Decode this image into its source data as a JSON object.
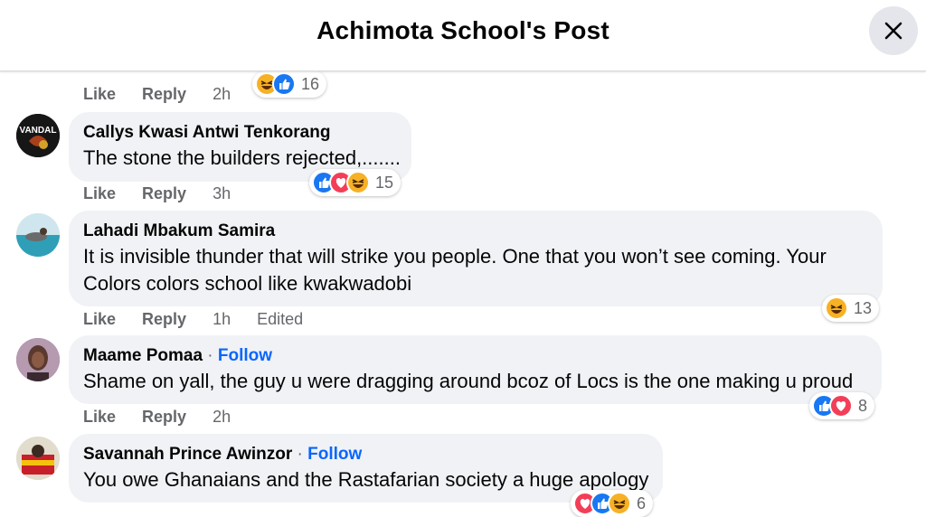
{
  "header": {
    "title": "Achimota School's Post"
  },
  "colors": {
    "link": "#0866ff",
    "like": "#1877f2",
    "love": "#f33e58",
    "haha": "#f7b125",
    "bubble": "#f0f2f5"
  },
  "prev_comment": {
    "actions": {
      "like": "Like",
      "reply": "Reply",
      "time": "2h"
    },
    "reactions": {
      "icons": [
        "haha-icon",
        "like-icon"
      ],
      "count": "16"
    }
  },
  "comments": [
    {
      "author": "Callys Kwasi Antwi Tenkorang",
      "avatar_text": "VANDAL",
      "text_lines": [
        "The stone the builders rejected,......."
      ],
      "actions": {
        "like": "Like",
        "reply": "Reply",
        "time": "3h"
      },
      "reactions": {
        "icons": [
          "like-icon",
          "love-icon",
          "haha-icon"
        ],
        "count": "15"
      }
    },
    {
      "author": "Lahadi Mbakum Samira",
      "text_lines": [
        "It is invisible thunder that will strike you people. One that you won’t see coming. Your",
        "Colors colors school like kwakwadobi"
      ],
      "actions": {
        "like": "Like",
        "reply": "Reply",
        "time": "1h",
        "edited": "Edited"
      },
      "reactions": {
        "icons": [
          "haha-icon"
        ],
        "count": "13"
      }
    },
    {
      "author": "Maame Pomaa",
      "separator": "·",
      "follow": "Follow",
      "text_lines": [
        "Shame on yall, the guy u were dragging around bcoz of Locs is the one making u proud"
      ],
      "actions": {
        "like": "Like",
        "reply": "Reply",
        "time": "2h"
      },
      "reactions": {
        "icons": [
          "like-icon",
          "love-icon"
        ],
        "count": "8"
      }
    },
    {
      "author": "Savannah Prince Awinzor",
      "separator": "·",
      "follow": "Follow",
      "text_lines": [
        "You owe Ghanaians and the Rastafarian society a huge apology"
      ],
      "reactions": {
        "icons": [
          "love-icon",
          "like-icon",
          "haha-icon"
        ],
        "count": "6"
      }
    }
  ]
}
